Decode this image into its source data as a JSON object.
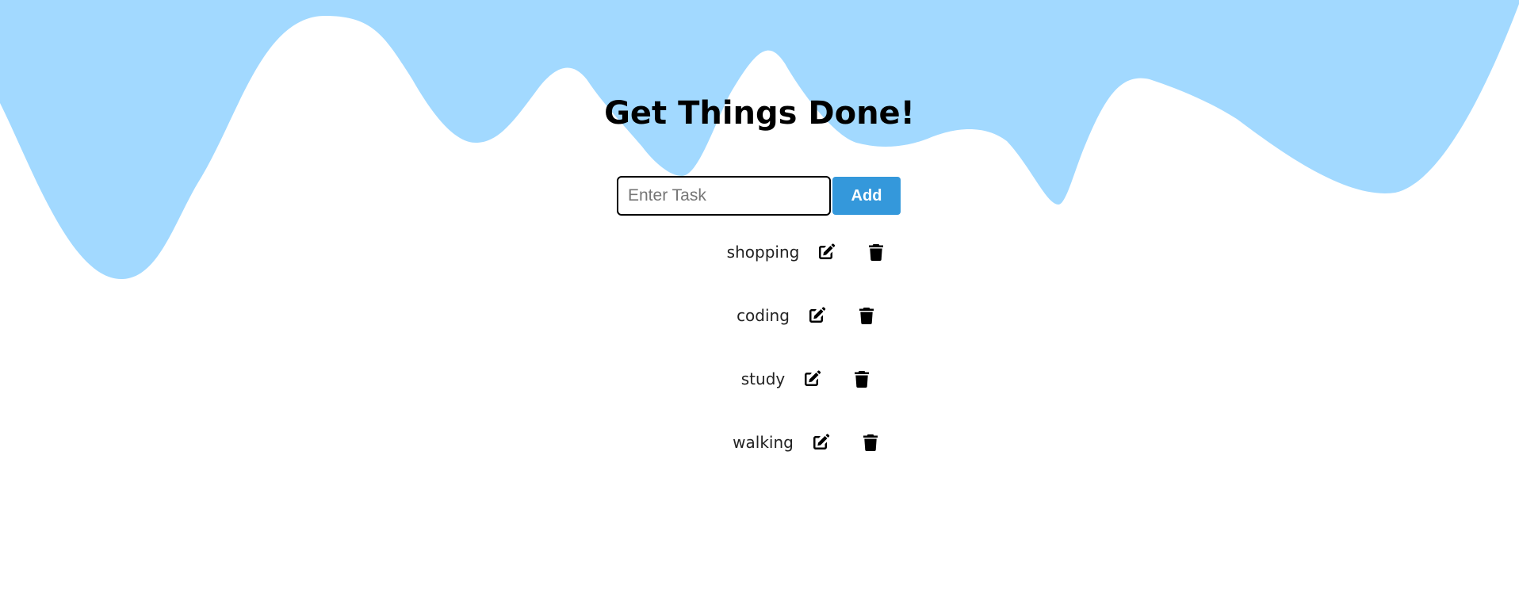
{
  "header": {
    "title": "Get Things Done!"
  },
  "form": {
    "placeholder": "Enter Task",
    "value": "",
    "add_label": "Add"
  },
  "tasks": [
    {
      "label": "shopping"
    },
    {
      "label": "coding"
    },
    {
      "label": "study"
    },
    {
      "label": "walking"
    }
  ],
  "icons": {
    "edit": "edit-icon",
    "delete": "trash-icon"
  },
  "colors": {
    "wave": "#a2d9ff",
    "accent": "#3498db",
    "text": "#000000"
  }
}
